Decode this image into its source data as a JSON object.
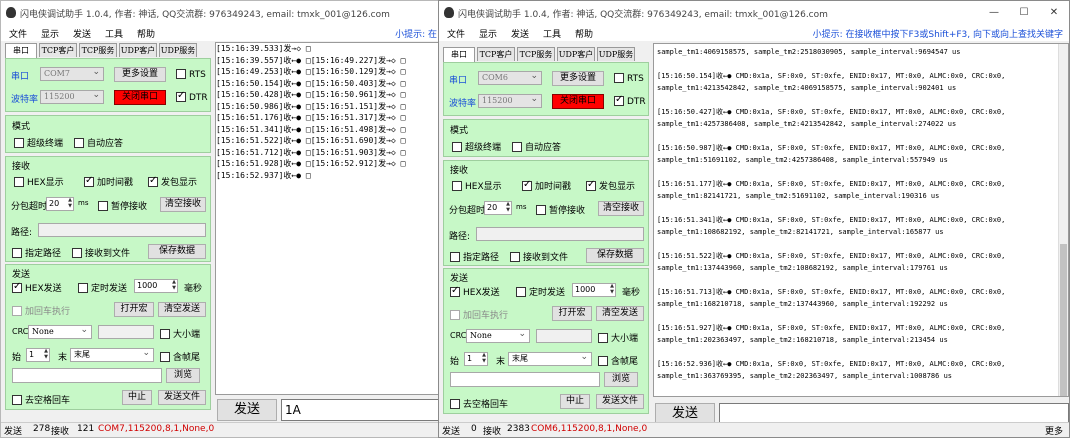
{
  "w1": {
    "title": "闪电侠调试助手 1.0.4, 作者: 神话, QQ交流群: 976349243, email: tmxk_001@126.com",
    "menu": [
      "文件",
      "显示",
      "发送",
      "工具",
      "帮助"
    ],
    "hint": "小提示: 在",
    "tabs": [
      "串口",
      "TCP客户",
      "TCP服务",
      "UDP客户",
      "UDP服务"
    ],
    "port_label": "串口",
    "port_value": "COM7",
    "baud_label": "波特率",
    "baud_value": "115200",
    "more_settings": "更多设置",
    "close_port": "关闭串口",
    "rts": "RTS",
    "dtr": "DTR",
    "mode_title": "模式",
    "super_terminal": "超级终端",
    "auto_reply": "自动应答",
    "recv_title": "接收",
    "hex_display": "HEX显示",
    "add_timestamp": "加时间戳",
    "show_sent": "发包显示",
    "split_timeout": "分包超时",
    "split_value": "20",
    "ms": "ms",
    "pause_recv": "暂停接收",
    "clear_recv": "清空接收",
    "path_label": "路径:",
    "specify_path": "指定路径",
    "recv_to_file": "接收到文件",
    "save_data": "保存数据",
    "send_title": "发送",
    "hex_send": "HEX发送",
    "timed_send": "定时发送",
    "timed_value": "1000",
    "ms_cn": "毫秒",
    "add_crlf": "加回车执行",
    "open_macro": "打开宏",
    "clear_send": "清空发送",
    "crc_label": "CRC",
    "crc_value": "None",
    "big_endian": "大小端",
    "start_label": "始",
    "start_value": "1",
    "end_label": "末",
    "end_value": "末尾",
    "include_tail": "含帧尾",
    "browse": "浏览",
    "remove_spaces": "去空格回车",
    "interrupt": "中止",
    "send_file": "发送文件",
    "send_button": "发送",
    "send_input": "1A",
    "log": [
      "[15:16:39.533]发→◇ □",
      "[15:16:39.557]收←● □[15:16:49.227]发→◇ □",
      "[15:16:49.253]收←● □[15:16:50.129]发→◇ □",
      "[15:16:50.154]收←● □[15:16:50.403]发→◇ □",
      "[15:16:50.428]收←● □[15:16:50.961]发→◇ □",
      "[15:16:50.986]收←● □[15:16:51.151]发→◇ □",
      "[15:16:51.176]收←● □[15:16:51.317]发→◇ □",
      "[15:16:51.341]收←● □[15:16:51.498]发→◇ □",
      "[15:16:51.522]收←● □[15:16:51.690]发→◇ □",
      "[15:16:51.712]收←● □[15:16:51.903]发→◇ □",
      "[15:16:51.928]收←● □[15:16:52.912]发→◇ □",
      "[15:16:52.937]收←● □"
    ],
    "status_send_label": "发送",
    "status_send": "278",
    "status_recv_label": "接收",
    "status_recv": "121",
    "status_port": "COM7,115200,8,1,None,0"
  },
  "w2": {
    "title": "闪电侠调试助手 1.0.4, 作者: 神话, QQ交流群: 976349243, email: tmxk_001@126.com",
    "menu": [
      "文件",
      "显示",
      "发送",
      "工具",
      "帮助"
    ],
    "hint": "小提示: 在接收框中按下F3或Shift+F3, 向下或向上查找关键字",
    "tabs": [
      "串口",
      "TCP客户",
      "TCP服务",
      "UDP客户",
      "UDP服务"
    ],
    "port_label": "串口",
    "port_value": "COM6",
    "baud_label": "波特率",
    "baud_value": "115200",
    "more_settings": "更多设置",
    "close_port": "关闭串口",
    "rts": "RTS",
    "dtr": "DTR",
    "mode_title": "模式",
    "super_terminal": "超级终端",
    "auto_reply": "自动应答",
    "recv_title": "接收",
    "hex_display": "HEX显示",
    "add_timestamp": "加时间戳",
    "show_sent": "发包显示",
    "split_timeout": "分包超时",
    "split_value": "20",
    "ms": "ms",
    "pause_recv": "暂停接收",
    "clear_recv": "清空接收",
    "path_label": "路径:",
    "specify_path": "指定路径",
    "recv_to_file": "接收到文件",
    "save_data": "保存数据",
    "send_title": "发送",
    "hex_send": "HEX发送",
    "timed_send": "定时发送",
    "timed_value": "1000",
    "ms_cn": "毫秒",
    "add_crlf": "加回车执行",
    "open_macro": "打开宏",
    "clear_send": "清空发送",
    "crc_label": "CRC",
    "crc_value": "None",
    "big_endian": "大小端",
    "start_label": "始",
    "start_value": "1",
    "end_label": "末",
    "end_value": "末尾",
    "include_tail": "含帧尾",
    "browse": "浏览",
    "remove_spaces": "去空格回车",
    "interrupt": "中止",
    "send_file": "发送文件",
    "send_button": "发送",
    "send_input": "",
    "log": [
      "sample_tm1:4069158575, sample_tm2:2518030905, sample_interval:9694547 us",
      "",
      "[15:16:50.154]收←● CMD:0x1a, SF:0x0, ST:0xfe, ENID:0x17, MT:0x0, ALMC:0x0, CRC:0x0,",
      "sample_tm1:4213542842, sample_tm2:4069158575, sample_interval:902401 us",
      "",
      "[15:16:50.427]收←● CMD:0x1a, SF:0x0, ST:0xfe, ENID:0x17, MT:0x0, ALMC:0x0, CRC:0x0,",
      "sample_tm1:4257386408, sample_tm2:4213542842, sample_interval:274022 us",
      "",
      "[15:16:50.987]收←● CMD:0x1a, SF:0x0, ST:0xfe, ENID:0x17, MT:0x0, ALMC:0x0, CRC:0x0,",
      "sample_tm1:51691102, sample_tm2:4257386408, sample_interval:557949 us",
      "",
      "[15:16:51.177]收←● CMD:0x1a, SF:0x0, ST:0xfe, ENID:0x17, MT:0x0, ALMC:0x0, CRC:0x0,",
      "sample_tm1:82141721, sample_tm2:51691102, sample_interval:190316 us",
      "",
      "[15:16:51.341]收←● CMD:0x1a, SF:0x0, ST:0xfe, ENID:0x17, MT:0x0, ALMC:0x0, CRC:0x0,",
      "sample_tm1:108682192, sample_tm2:82141721, sample_interval:165877 us",
      "",
      "[15:16:51.522]收←● CMD:0x1a, SF:0x0, ST:0xfe, ENID:0x17, MT:0x0, ALMC:0x0, CRC:0x0,",
      "sample_tm1:137443960, sample_tm2:108682192, sample_interval:179761 us",
      "",
      "[15:16:51.713]收←● CMD:0x1a, SF:0x0, ST:0xfe, ENID:0x17, MT:0x0, ALMC:0x0, CRC:0x0,",
      "sample_tm1:168210718, sample_tm2:137443960, sample_interval:192292 us",
      "",
      "[15:16:51.927]收←● CMD:0x1a, SF:0x0, ST:0xfe, ENID:0x17, MT:0x0, ALMC:0x0, CRC:0x0,",
      "sample_tm1:202363497, sample_tm2:168210718, sample_interval:213454 us",
      "",
      "[15:16:52.936]收←● CMD:0x1a, SF:0x0, ST:0xfe, ENID:0x17, MT:0x0, ALMC:0x0, CRC:0x0,",
      "sample_tm1:363769395, sample_tm2:202363497, sample_interval:1008786 us"
    ],
    "status_send_label": "发送",
    "status_send": "0",
    "status_recv_label": "接收",
    "status_recv": "2383",
    "status_port": "COM6,115200,8,1,None,0",
    "status_more": "更多"
  }
}
